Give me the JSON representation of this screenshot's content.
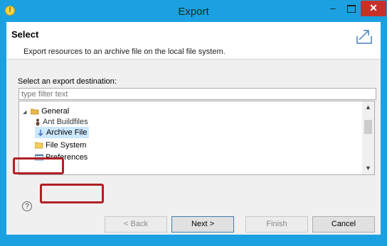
{
  "window": {
    "title": "Export"
  },
  "header": {
    "title": "Select",
    "description": "Export resources to an archive file on the local file system."
  },
  "destination": {
    "label": "Select an export destination:",
    "filter_placeholder": "type filter text",
    "tree": [
      {
        "label": "General",
        "icon": "folder-open-icon",
        "expanded": true,
        "level": 0
      },
      {
        "label": "Ant Buildfiles",
        "icon": "ant-icon",
        "level": 1
      },
      {
        "label": "Archive File",
        "icon": "archive-file-icon",
        "level": 1,
        "selected": true
      },
      {
        "label": "File System",
        "icon": "folder-icon",
        "level": 1
      },
      {
        "label": "Preferences",
        "icon": "preferences-icon",
        "level": 1
      }
    ]
  },
  "buttons": {
    "back": "< Back",
    "next": "Next >",
    "finish": "Finish",
    "cancel": "Cancel"
  },
  "colors": {
    "titlebar": "#1ba1e2",
    "close": "#c7312a",
    "highlight": "#b21f25",
    "selection": "#cce8ff"
  }
}
